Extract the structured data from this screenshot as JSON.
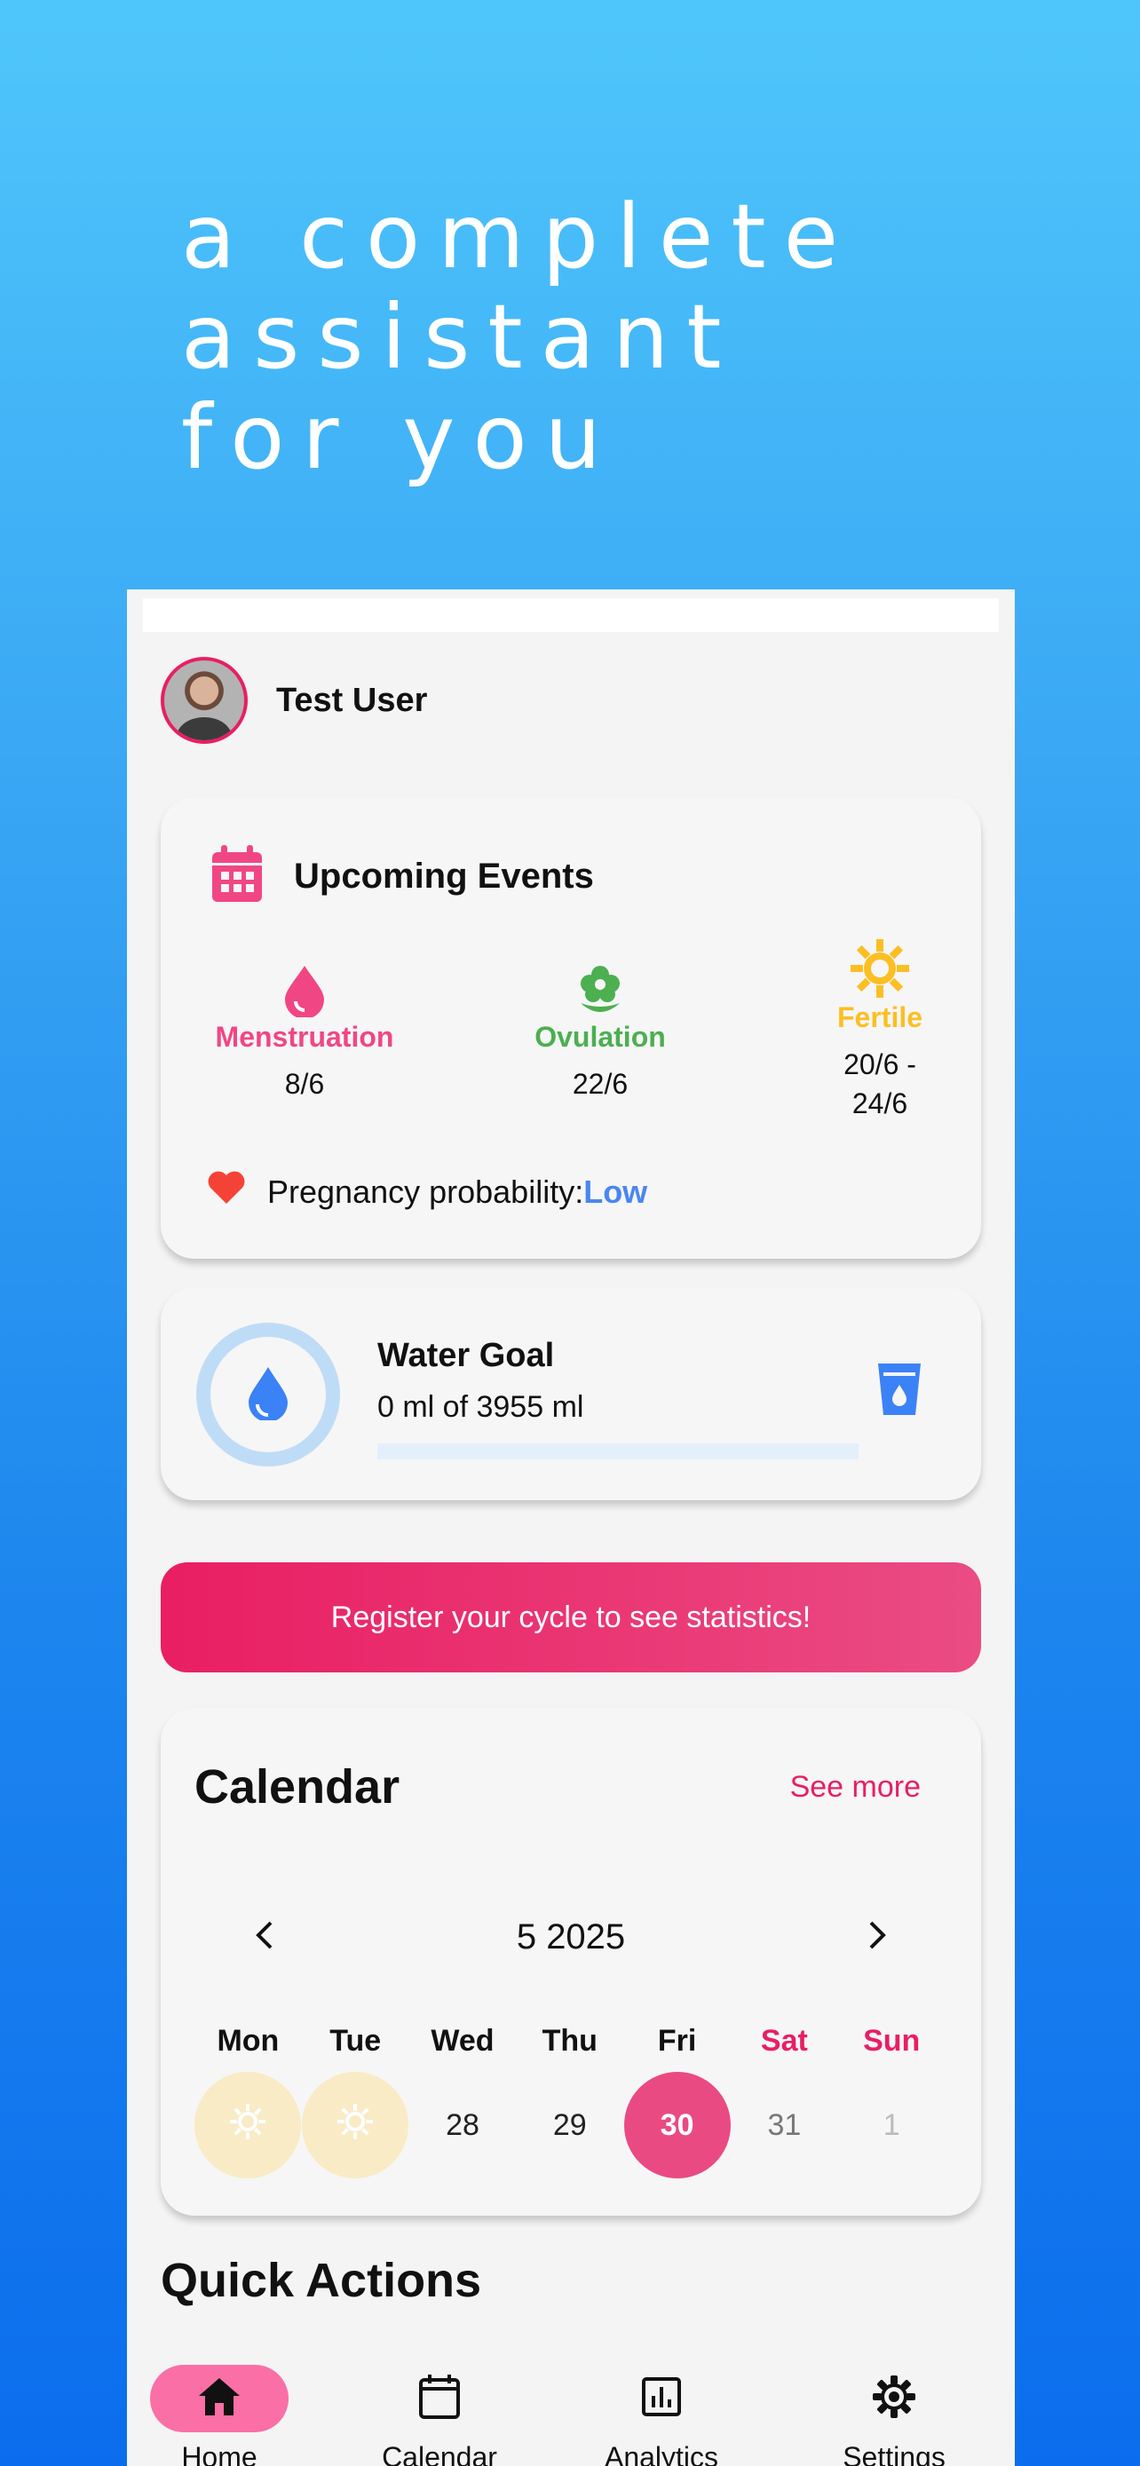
{
  "hero": {
    "line1": "a complete",
    "line2": "assistant",
    "line3": "for you"
  },
  "profile": {
    "username": "Test User"
  },
  "upcoming_events": {
    "title": "Upcoming Events",
    "menstruation": {
      "label": "Menstruation",
      "date": "8/6",
      "color": "#f04784"
    },
    "ovulation": {
      "label": "Ovulation",
      "date": "22/6",
      "color": "#4caf50"
    },
    "fertile": {
      "label": "Fertile",
      "date_line1": "20/6 -",
      "date_line2": "24/6",
      "color": "#fbbf24"
    },
    "pregnancy_label": "Pregnancy probability:",
    "pregnancy_value": "Low"
  },
  "water": {
    "title": "Water Goal",
    "summary": "0 ml of 3955 ml",
    "progress_fraction": 0
  },
  "register_banner": {
    "text": "Register your cycle to see statistics!"
  },
  "calendar": {
    "title": "Calendar",
    "see_more": "See more",
    "month_label": "5 2025",
    "day_names": [
      "Mon",
      "Tue",
      "Wed",
      "Thu",
      "Fri",
      "Sat",
      "Sun"
    ],
    "dates": [
      "28",
      "29",
      "30",
      "31",
      "1"
    ]
  },
  "quick_actions": {
    "title": "Quick Actions"
  },
  "nav": {
    "home": "Home",
    "calendar": "Calendar",
    "analytics": "Analytics",
    "settings": "Settings"
  },
  "colors": {
    "accent": "#e91e63",
    "blue": "#4a86f0"
  }
}
